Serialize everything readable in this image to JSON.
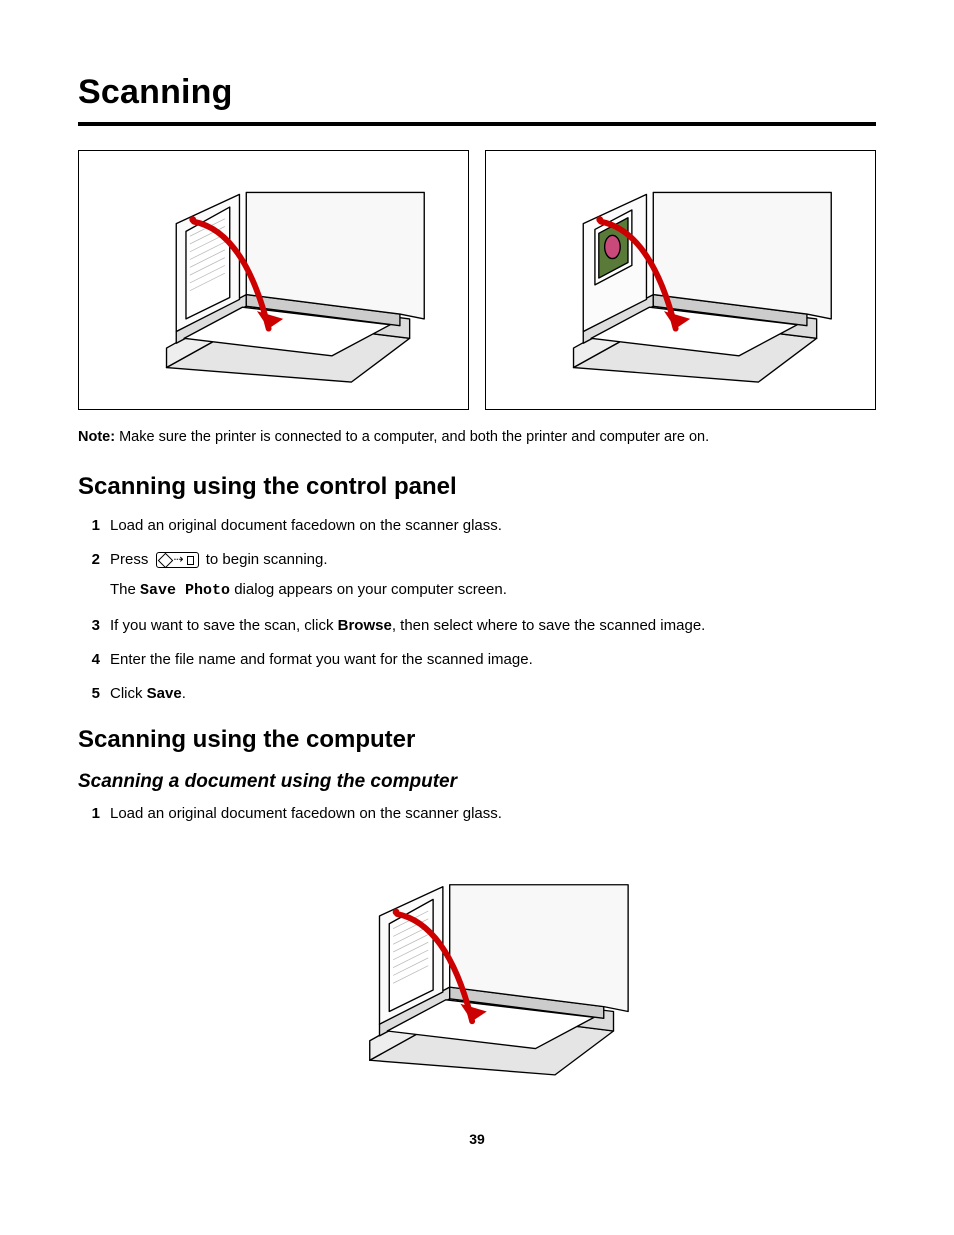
{
  "title": "Scanning",
  "note": {
    "label": "Note:",
    "text": "Make sure the printer is connected to a computer, and both the printer and computer are on."
  },
  "sections": {
    "controlPanel": {
      "heading": "Scanning using the control panel",
      "step1": "Load an original document facedown on the scanner glass.",
      "step2_a": "Press",
      "step2_b": "to begin scanning.",
      "step2_sub_a": "The",
      "step2_sub_mono": "Save Photo",
      "step2_sub_b": "dialog appears on your computer screen.",
      "step3_a": "If you want to save the scan, click",
      "step3_bold": "Browse",
      "step3_b": ", then select where to save the scanned image.",
      "step4": "Enter the file name and format you want for the scanned image.",
      "step5_a": "Click",
      "step5_bold": "Save",
      "step5_b": "."
    },
    "computer": {
      "heading": "Scanning using the computer",
      "subheading": "Scanning a document using the computer",
      "step1": "Load an original document facedown on the scanner glass."
    }
  },
  "pageNumber": "39",
  "nums": {
    "1": "1",
    "2": "2",
    "3": "3",
    "4": "4",
    "5": "5"
  }
}
